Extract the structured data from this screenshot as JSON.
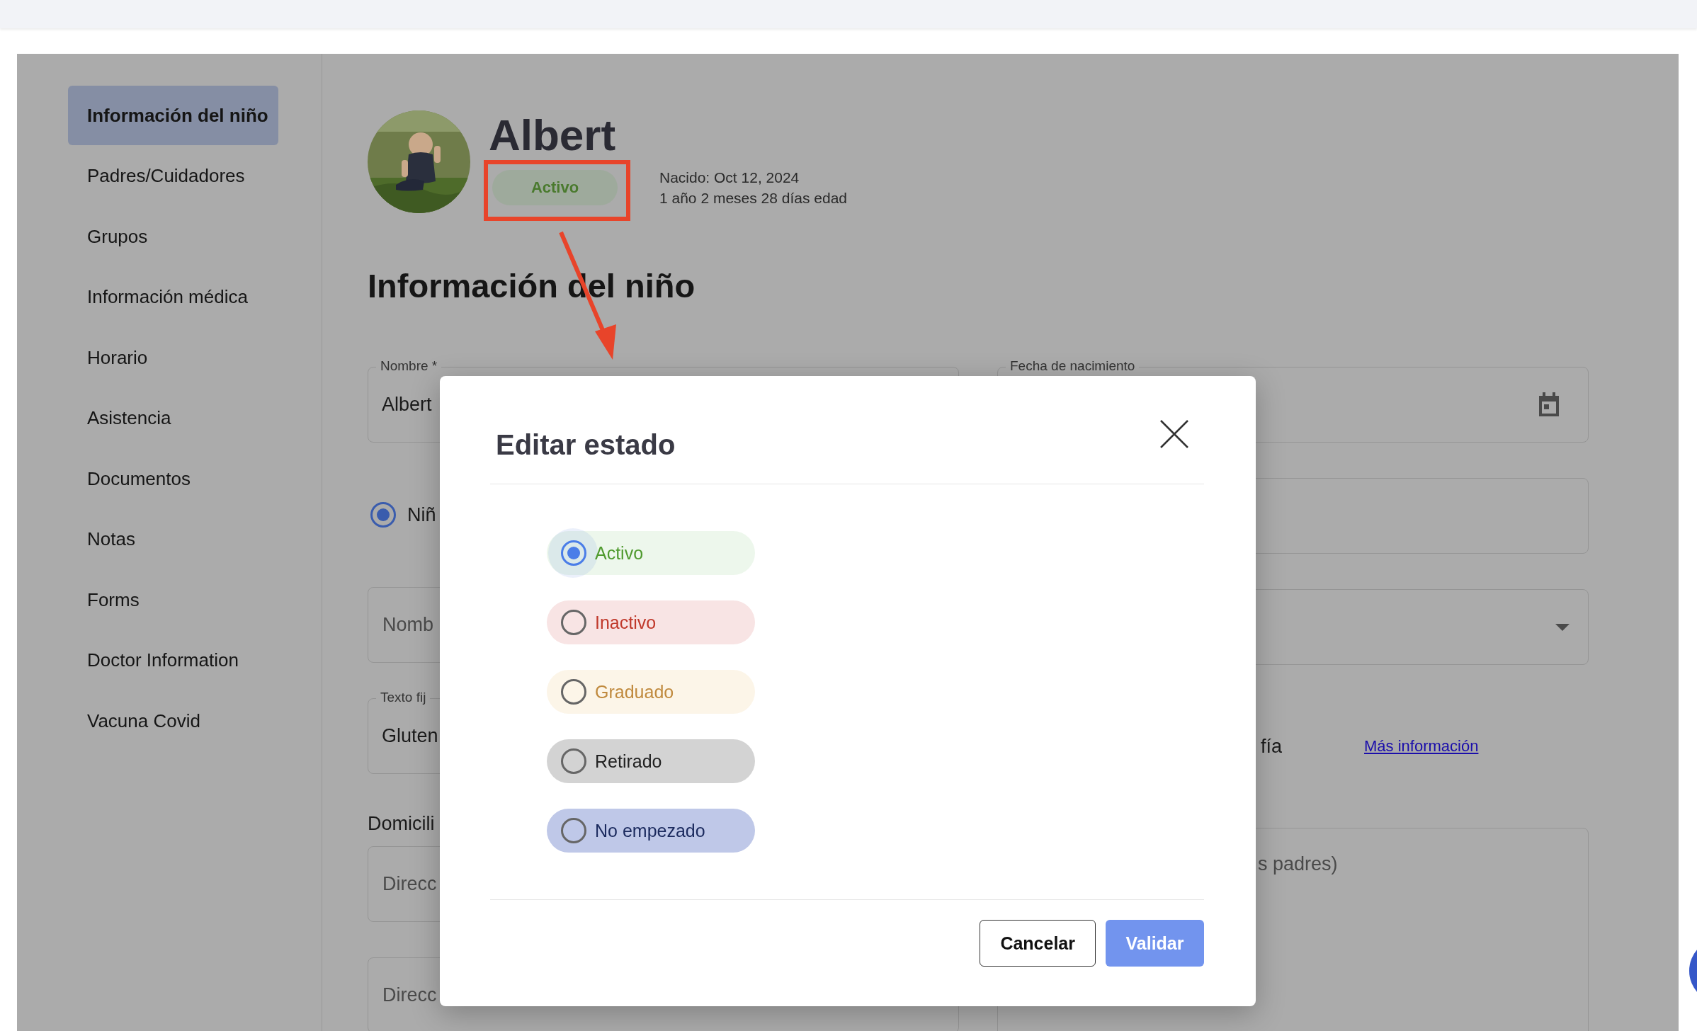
{
  "sidebar": {
    "items": [
      {
        "label": "Información del niño",
        "selected": true
      },
      {
        "label": "Padres/Cuidadores",
        "selected": false
      },
      {
        "label": "Grupos",
        "selected": false
      },
      {
        "label": "Información médica",
        "selected": false
      },
      {
        "label": "Horario",
        "selected": false
      },
      {
        "label": "Asistencia",
        "selected": false
      },
      {
        "label": "Documentos",
        "selected": false
      },
      {
        "label": "Notas",
        "selected": false
      },
      {
        "label": "Forms",
        "selected": false
      },
      {
        "label": "Doctor Information",
        "selected": false
      },
      {
        "label": "Vacuna Covid",
        "selected": false
      }
    ]
  },
  "profile": {
    "name": "Albert",
    "status": "Activo",
    "born": "Nacido: Oct 12, 2024",
    "age": "1 año 2 meses 28 días edad"
  },
  "section_title": "Información del niño",
  "form": {
    "left": [
      {
        "kind": "field",
        "label": "Nombre *",
        "value": "Albert"
      },
      {
        "kind": "radio",
        "label": "Niñ",
        "checked": true
      },
      {
        "kind": "field",
        "placeholder": "Nomb"
      },
      {
        "kind": "field",
        "label": "Texto fij",
        "value": "Gluten"
      },
      {
        "kind": "heading",
        "text": "Domicili"
      },
      {
        "kind": "field",
        "placeholder": "Direcc"
      },
      {
        "kind": "field",
        "placeholder": "Direcc"
      }
    ],
    "right": [
      {
        "kind": "date",
        "label": "Fecha de nacimiento"
      },
      {
        "kind": "field"
      },
      {
        "kind": "select"
      },
      {
        "kind": "link_row",
        "text": "fía",
        "link": "Más información"
      },
      {
        "kind": "textarea",
        "placeholder": "s padres)"
      }
    ]
  },
  "modal": {
    "title": "Editar estado",
    "options": [
      {
        "label": "Activo",
        "kind": "active",
        "selected": true
      },
      {
        "label": "Inactivo",
        "kind": "inactive",
        "selected": false
      },
      {
        "label": "Graduado",
        "kind": "graduated",
        "selected": false
      },
      {
        "label": "Retirado",
        "kind": "withdrawn",
        "selected": false
      },
      {
        "label": "No empezado",
        "kind": "not_started",
        "selected": false
      }
    ],
    "buttons": [
      {
        "label": "Cancelar",
        "kind": "secondary"
      },
      {
        "label": "Validar",
        "kind": "primary"
      }
    ]
  }
}
